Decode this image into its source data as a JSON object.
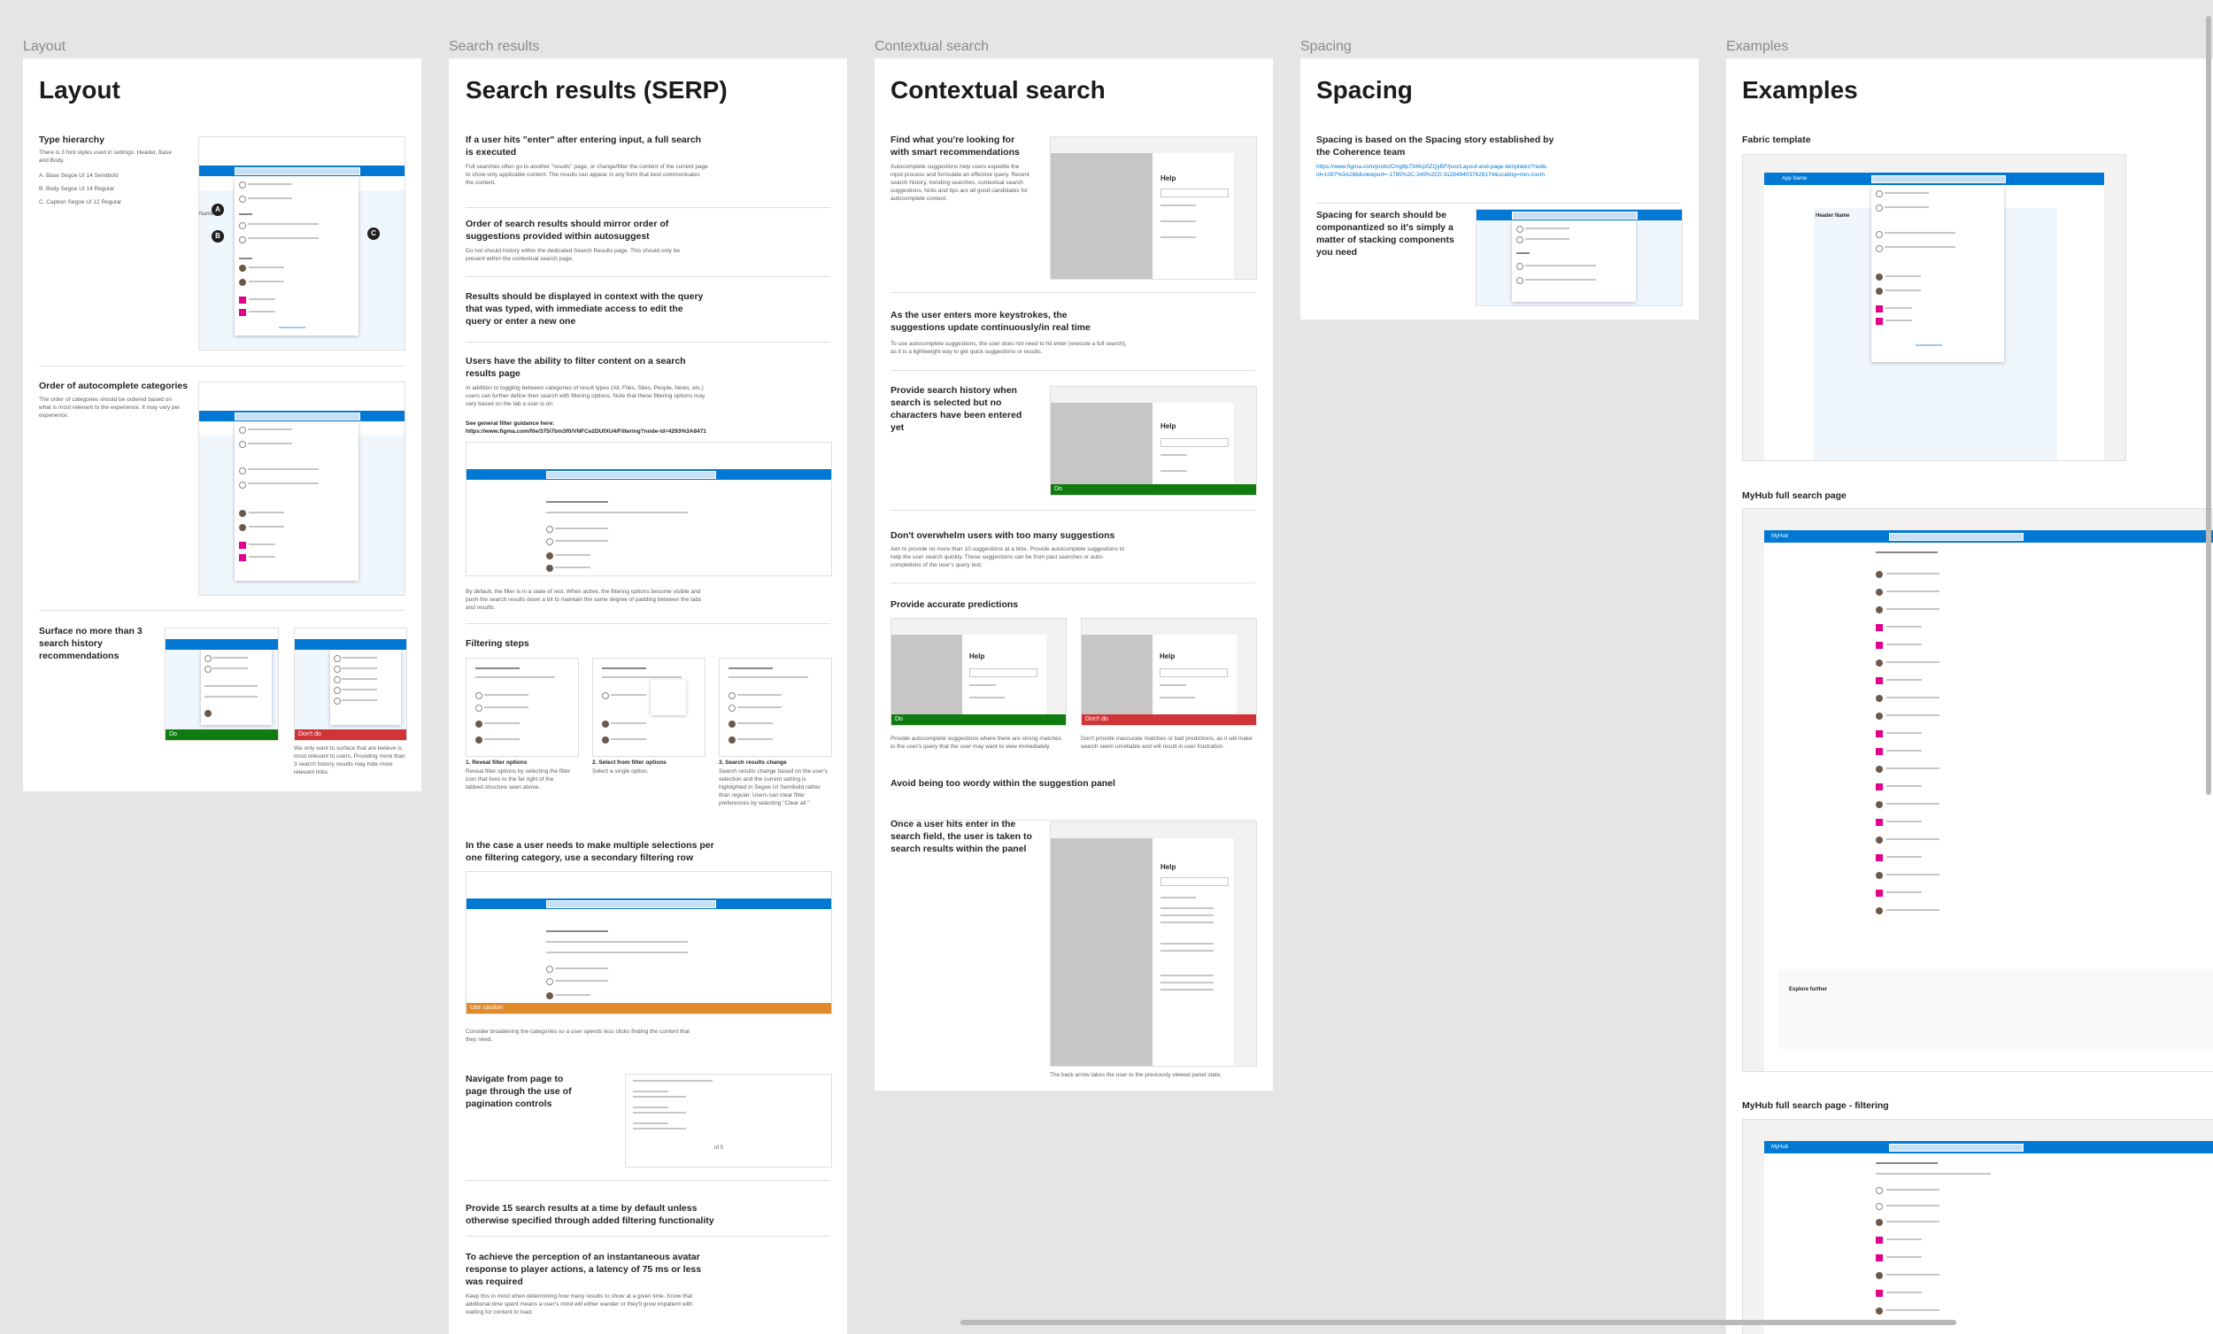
{
  "colors": {
    "accent": "#0078d4",
    "do": "#107c10",
    "dont": "#d13438",
    "caution": "#e08a2b",
    "avatar_pink": "#e3008c"
  },
  "frames": {
    "layout": {
      "label": "Layout",
      "title": "Layout",
      "type_hierarchy": {
        "heading": "Type hierarchy",
        "body": "There is 3 font styles used in settings: Header, Base and Body.",
        "items": [
          "A. Base Segoe UI 14 Semibold",
          "B. Body Segoe UI 14 Regular",
          "C. Caption Segoe UI 12 Regular"
        ]
      },
      "order": {
        "heading": "Order of autocomplete categories",
        "body": "The order of categories should be ordered based on what is most relevant to the experience. It may vary per experience."
      },
      "surface": {
        "heading": "Surface no more than 3 search history recommendations",
        "body": "We only want to surface that are believe is most relevant to users. Providing more than 3 search history results may hide more relevant links."
      },
      "badges": [
        "A",
        "B",
        "C"
      ],
      "do": "Do",
      "dont": "Don't do",
      "header_name": "Name"
    },
    "serp": {
      "label": "Search results",
      "title": "Search results (SERP)",
      "s1": {
        "heading": "If a user hits \"enter\" after entering input, a full search is executed",
        "body": "Full searches often go to another \"results\" page, or change/filter the content of the current page to show only applicable content. The results can appear in any form that best communicates the content."
      },
      "s2": {
        "heading": "Order of search results should mirror order of suggestions provided within autosuggest",
        "body": "Do not should history within the dedicated Search Results page. This should only be present within the contextual search page."
      },
      "s3": {
        "heading": "Results should be displayed in context with the query that was typed, with immediate access to edit the query or enter a new one"
      },
      "s4": {
        "heading": "Users have the ability to filter content on a search results page",
        "body": "In addition to toggling between categories of result types (All, Files, Sites, People, News, etc.) users can further define their search with filtering options. Note that these filtering options may vary based on the tab a user is on.",
        "guidance": "See general filter guidance here:",
        "url": "https://www.figma.com/file/375i7bm3f0/VNFCe2DUfXU4/Filtering?node-id=4293%3A8471",
        "caption": "By default, the filter is in a state of rest. When active, the filtering options become visible and push the search results down a bit to maintain the same degree of padding between the tabs and results."
      },
      "filtering": {
        "heading": "Filtering steps",
        "steps": [
          {
            "title": "1. Reveal filter options",
            "body": "Reveal filter options by selecting the filter icon that lives to the far right of the tabbed structure seen above."
          },
          {
            "title": "2. Select from filter options",
            "body": "Select a single option."
          },
          {
            "title": "3. Search results change",
            "body": "Search results change based on the user's selection and the current setting is highlighted in Segoe UI Semibold rather than regular. Users can clear filter preferences by selecting \"Clear all.\""
          }
        ]
      },
      "secondary": {
        "heading": "In the case a user needs to make multiple selections per one filtering category, use a secondary filtering row",
        "caution": "Use caution",
        "body": "Consider broadening the categories so a user spends less clicks finding the content that they need."
      },
      "pagination": {
        "heading": "Navigate from page to page through the use of pagination controls",
        "page": "of 5"
      },
      "s5": {
        "heading": "Provide 15 search results at a time by default unless otherwise specified through added filtering functionality"
      },
      "s6": {
        "heading": "To achieve the perception of an instantaneous avatar response to player actions, a latency of 75 ms or less was required",
        "body": "Keep this in mind when determining how many results to show at a given time. Know that additional time spent means a user's mind will either wander or they'll grow impatient with waiting for content to load."
      }
    },
    "contextual": {
      "label": "Contextual search",
      "title": "Contextual search",
      "c1": {
        "heading": "Find what you're looking for with smart recommendations",
        "body": "Autocomplete suggestions help users expedite the input process and formulate an effective query. Recent search history, trending searches, contextual search suggestions, hints and tips are all good candidates for autocomplete content."
      },
      "c2": {
        "heading": "As the user enters more keystrokes, the suggestions update continuously/in real time",
        "body": "To use autocomplete suggestions, the user does not need to hit enter (execute a full search), as it is a lightweight way to get quick suggestions or results."
      },
      "c3": {
        "heading": "Provide search history when search is selected but no characters have been entered yet"
      },
      "c4": {
        "heading": "Don't overwhelm users with too many suggestions",
        "body": "Aim to provide no more than 10 suggestions at a time. Provide autocomplete suggestions to help the user search quickly. These suggestions can be from past searches or auto-completions of the user's query text."
      },
      "c5": {
        "heading": "Provide accurate predictions",
        "do_body": "Provide autocomplete suggestions where there are strong matches to the user's query that the user may want to view immediately.",
        "dont_body": "Don't provide inaccurate matches or bad predictions, as it will make search seem unreliable and will result in user frustration."
      },
      "c6": {
        "heading": "Avoid being too wordy within the suggestion panel"
      },
      "c7": {
        "heading": "Once a user hits enter in the search field, the user is taken to search results within the panel",
        "caption": "The back arrow takes the user to the previously viewed panel state."
      },
      "help": "Help",
      "do": "Do",
      "dont": "Don't do"
    },
    "spacing": {
      "label": "Spacing",
      "title": "Spacing",
      "sp1": {
        "heading": "Spacing is based on the Spacing story established by the Coherence team",
        "url": "https://www.figma.com/proto/Cmg8p734fcp0ZQyBF/pxo/Layout-and-page-templates?node-id=1087%3A288&viewport=-1785%2C-349%2C0.3128494037628174&scaling=min-zoom"
      },
      "sp2": {
        "heading": "Spacing for search should be componantized so it's simply a matter of stacking components you need"
      }
    },
    "examples": {
      "label": "Examples",
      "title": "Examples",
      "fabric": "Fabric template",
      "app_name": "App Name",
      "header_name": "Header Name",
      "myhub": "MyHub full search page",
      "myhub_filter": "MyHub full search page - filtering",
      "brand": "MyHub",
      "explore": "Explore further"
    }
  }
}
